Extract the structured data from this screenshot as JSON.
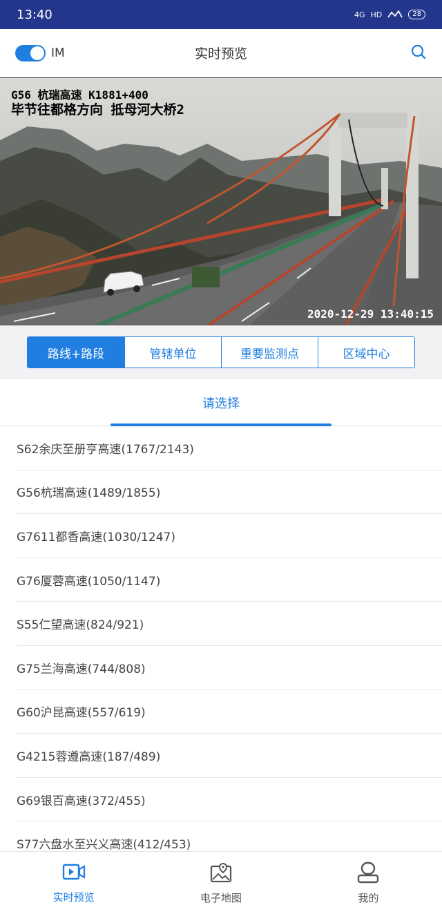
{
  "status_bar": {
    "time": "13:40",
    "network": "4G",
    "hd": "HD",
    "battery": "28"
  },
  "header": {
    "toggle_label": "IM",
    "title": "实时预览"
  },
  "camera": {
    "overlay_line1": "G56 杭瑞高速 K1881+400",
    "overlay_line2": "毕节往都格方向  抵母河大桥2",
    "timestamp": "2020-12-29 13:40:15"
  },
  "segment_tabs": [
    {
      "label": "路线+路段",
      "active": true
    },
    {
      "label": "管辖单位",
      "active": false
    },
    {
      "label": "重要监测点",
      "active": false
    },
    {
      "label": "区域中心",
      "active": false
    }
  ],
  "select_tab": {
    "label": "请选择"
  },
  "road_list": [
    "S62余庆至册亨高速(1767/2143)",
    "G56杭瑞高速(1489/1855)",
    "G7611都香高速(1030/1247)",
    "G76厦蓉高速(1050/1147)",
    "S55仁望高速(824/921)",
    "G75兰海高速(744/808)",
    "G60沪昆高速(557/619)",
    "G4215蓉遵高速(187/489)",
    "G69银百高速(372/455)",
    "S77六盘水至兴义高速(412/453)"
  ],
  "bottom_nav": [
    {
      "label": "实时预览",
      "icon": "video-preview-icon",
      "active": true
    },
    {
      "label": "电子地图",
      "icon": "map-icon",
      "active": false
    },
    {
      "label": "我的",
      "icon": "user-icon",
      "active": false
    }
  ],
  "colors": {
    "accent": "#1f7ee0",
    "status_bar": "#23368c"
  }
}
